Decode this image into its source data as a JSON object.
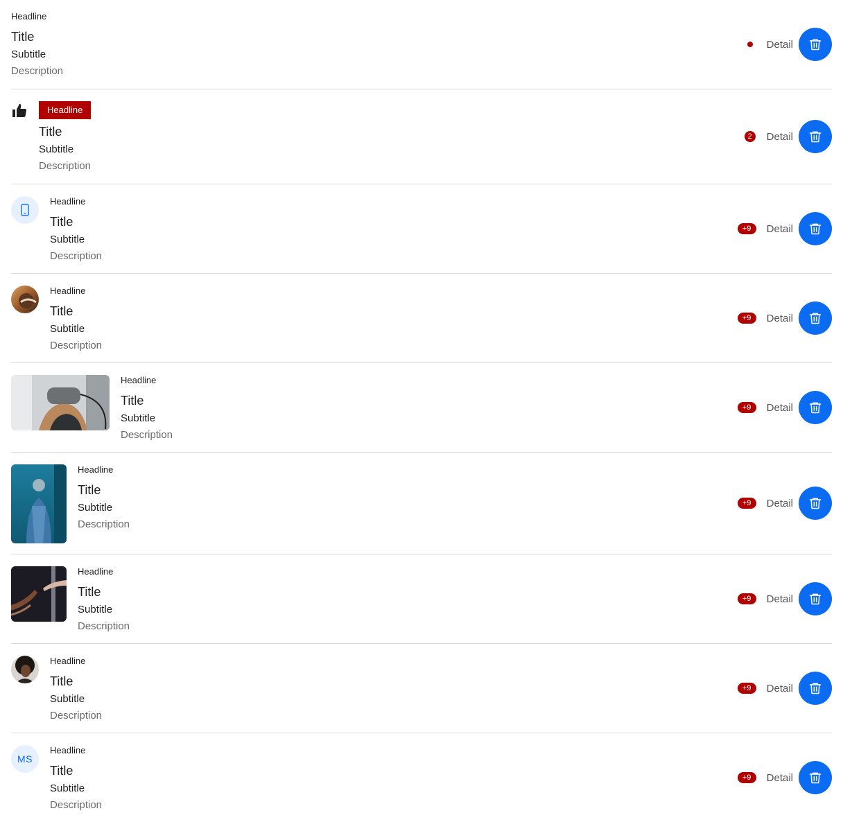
{
  "colors": {
    "accent": "#0b6cf2",
    "badge": "#b00000",
    "divider": "#d9d9d9",
    "avatar_bg": "#e6f0fe"
  },
  "items": [
    {
      "headline": "Headline",
      "title": "Title",
      "subtitle": "Subtitle",
      "description": "Description",
      "badge": "",
      "badge_type": "dot",
      "detail": "Detail",
      "action_icon": "trash-icon",
      "leading": "none"
    },
    {
      "headline": "Headline",
      "title": "Title",
      "subtitle": "Subtitle",
      "description": "Description",
      "badge": "2",
      "badge_type": "number",
      "detail": "Detail",
      "action_icon": "trash-icon",
      "leading": "thumbs-up-icon",
      "headline_style": "tag"
    },
    {
      "headline": "Headline",
      "title": "Title",
      "subtitle": "Subtitle",
      "description": "Description",
      "badge": "+9",
      "badge_type": "number",
      "detail": "Detail",
      "action_icon": "trash-icon",
      "leading": "mobile-phone-icon"
    },
    {
      "headline": "Headline",
      "title": "Title",
      "subtitle": "Subtitle",
      "description": "Description",
      "badge": "+9",
      "badge_type": "number",
      "detail": "Detail",
      "action_icon": "trash-icon",
      "leading": "avatar-photo"
    },
    {
      "headline": "Headline",
      "title": "Title",
      "subtitle": "Subtitle",
      "description": "Description",
      "badge": "+9",
      "badge_type": "number",
      "detail": "Detail",
      "action_icon": "trash-icon",
      "leading": "image-wide"
    },
    {
      "headline": "Headline",
      "title": "Title",
      "subtitle": "Subtitle",
      "description": "Description",
      "badge": "+9",
      "badge_type": "number",
      "detail": "Detail",
      "action_icon": "trash-icon",
      "leading": "image-tall"
    },
    {
      "headline": "Headline",
      "title": "Title",
      "subtitle": "Subtitle",
      "description": "Description",
      "badge": "+9",
      "badge_type": "number",
      "detail": "Detail",
      "action_icon": "trash-icon",
      "leading": "image-square"
    },
    {
      "headline": "Headline",
      "title": "Title",
      "subtitle": "Subtitle",
      "description": "Description",
      "badge": "+9",
      "badge_type": "number",
      "detail": "Detail",
      "action_icon": "trash-icon",
      "leading": "avatar-photo"
    },
    {
      "headline": "Headline",
      "title": "Title",
      "subtitle": "Subtitle",
      "description": "Description",
      "badge": "+9",
      "badge_type": "number",
      "detail": "Detail",
      "action_icon": "trash-icon",
      "leading": "avatar-initials",
      "initials": "MS"
    }
  ]
}
